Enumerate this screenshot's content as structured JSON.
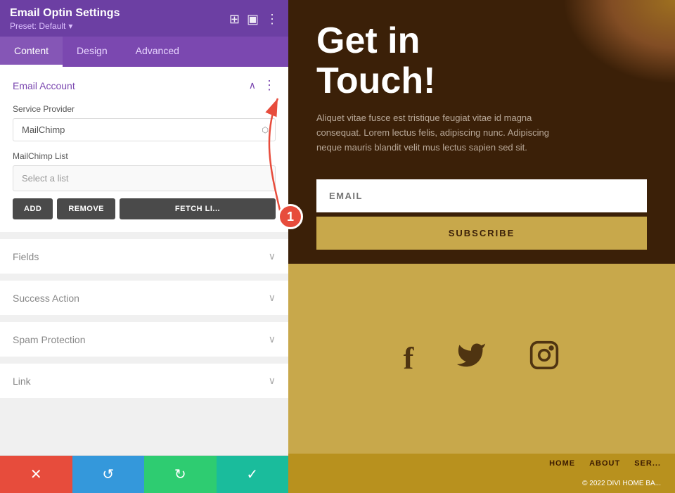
{
  "header": {
    "title": "Email Optin Settings",
    "preset_label": "Preset: Default",
    "preset_arrow": "▾",
    "icons": [
      "⊞",
      "▣",
      "⋮"
    ]
  },
  "tabs": [
    {
      "label": "Content",
      "active": true
    },
    {
      "label": "Design",
      "active": false
    },
    {
      "label": "Advanced",
      "active": false
    }
  ],
  "sections": {
    "email_account": {
      "title": "Email Account",
      "open": true,
      "service_provider_label": "Service Provider",
      "service_provider_value": "MailChimp",
      "mailchimp_list_label": "MailChimp List",
      "list_placeholder": "Select a list",
      "btn_add": "ADD",
      "btn_remove": "REMOVE",
      "btn_fetch": "FETCH LI..."
    },
    "fields": {
      "title": "Fields"
    },
    "success_action": {
      "title": "Success Action"
    },
    "spam_protection": {
      "title": "Spam Protection"
    },
    "link": {
      "title": "Link"
    }
  },
  "bottom_bar": {
    "close": "✕",
    "undo": "↺",
    "redo": "↻",
    "save": "✓"
  },
  "right_panel": {
    "hero_title_line1": "Get in",
    "hero_title_line2": "Touch!",
    "hero_text": "Aliquet vitae fusce est tristique feugiat vitae id magna consequat. Lorem lectus felis, adipiscing nunc. Adipiscing neque mauris blandit velit mus lectus sapien sed sit.",
    "email_placeholder": "EMAIL",
    "subscribe_label": "SUBSCRIBE",
    "social_icons": [
      "f",
      "🐦",
      "◯"
    ],
    "footer_links": [
      "HOME",
      "ABOUT",
      "SER..."
    ],
    "footer_copy": "© 2022 DIVI HOME BA..."
  },
  "badge": {
    "number": "1"
  }
}
